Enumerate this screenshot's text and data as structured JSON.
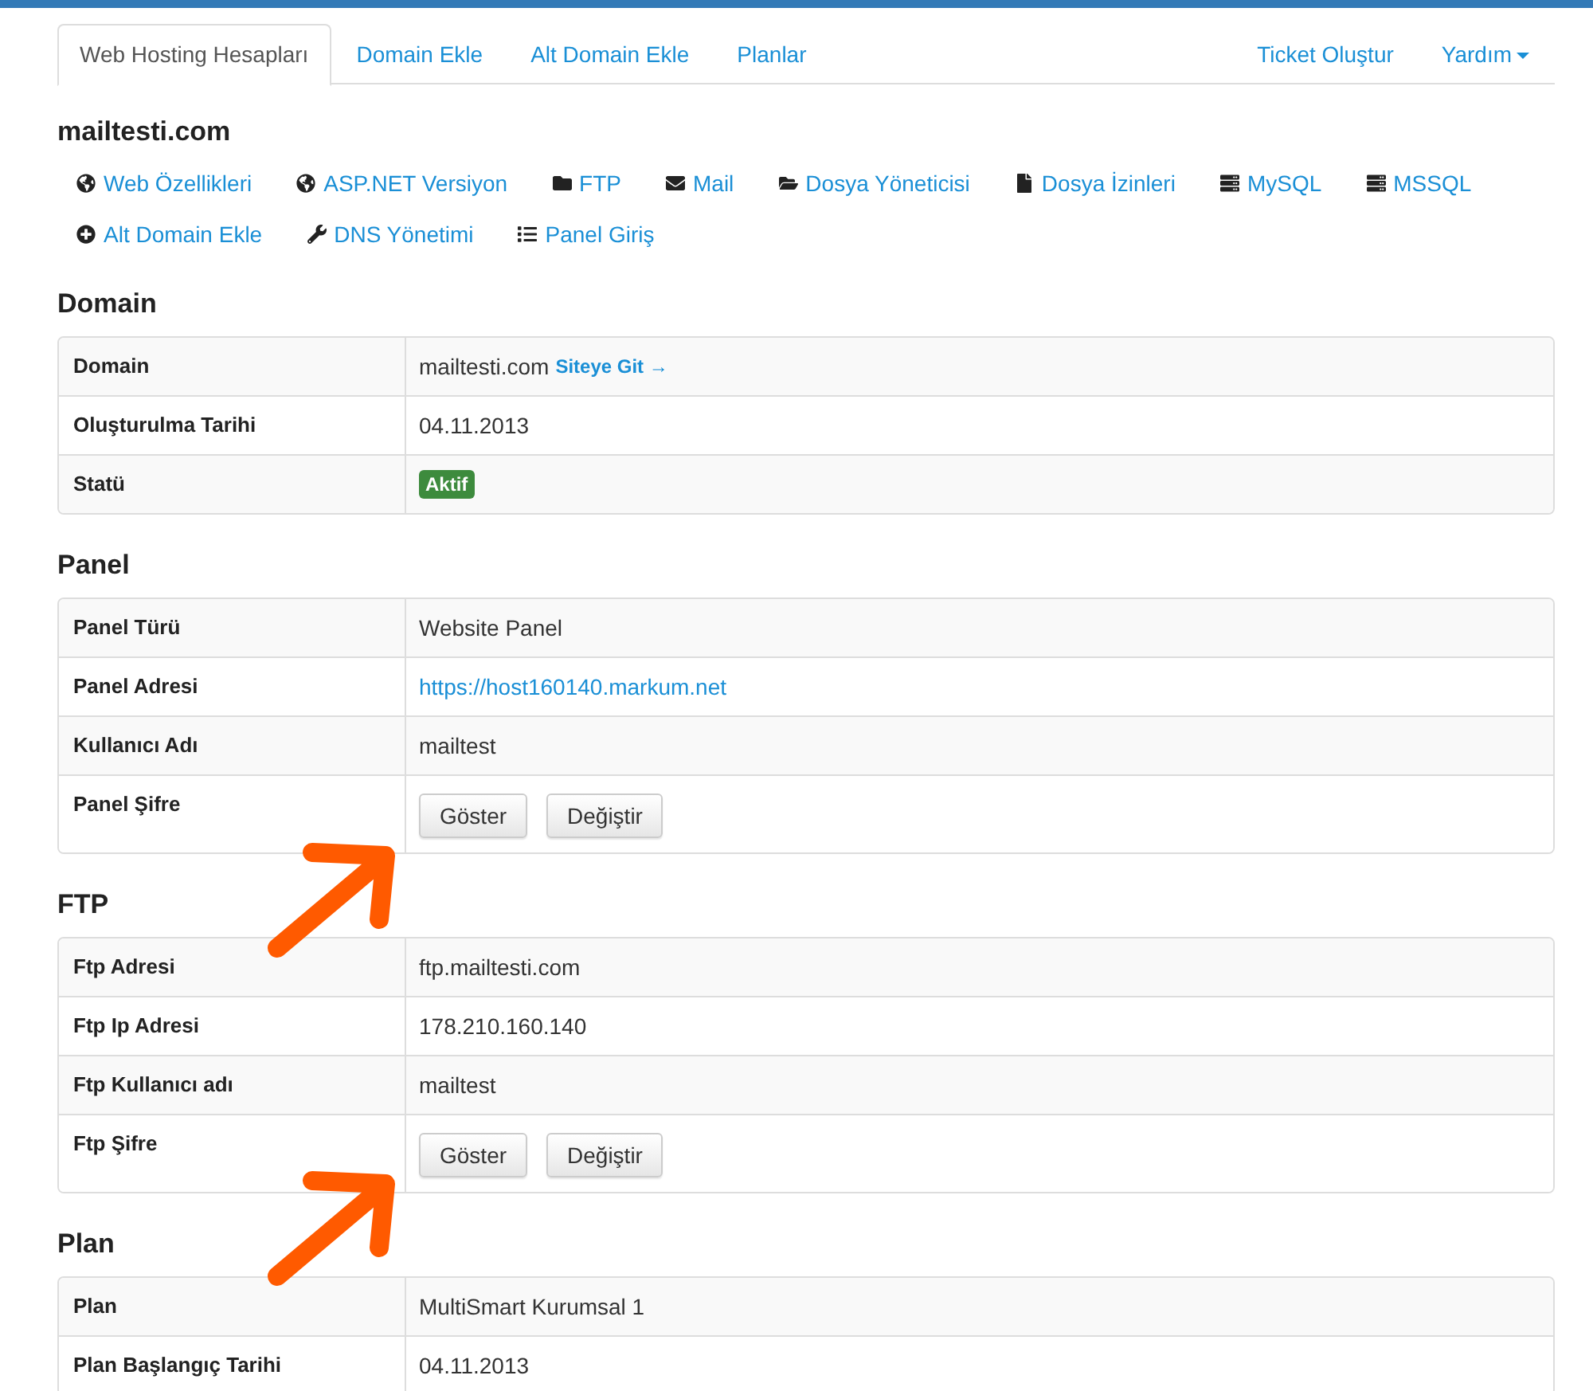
{
  "tabs": [
    {
      "label": "Web Hosting Hesapları",
      "selected": true
    },
    {
      "label": "Domain Ekle",
      "selected": false
    },
    {
      "label": "Alt Domain Ekle",
      "selected": false
    },
    {
      "label": "Planlar",
      "selected": false
    }
  ],
  "right_tabs": [
    {
      "label": "Ticket Oluştur",
      "kind": "link"
    },
    {
      "label": "Yardım",
      "kind": "dropdown"
    }
  ],
  "title": "mailtesti.com",
  "actions": [
    {
      "label": "Web Özellikleri",
      "kind": "globe"
    },
    {
      "label": "ASP.NET Versiyon",
      "kind": "globe"
    },
    {
      "label": "FTP",
      "kind": "folder"
    },
    {
      "label": "Mail",
      "kind": "envelope"
    },
    {
      "label": "Dosya Yöneticisi",
      "kind": "folder-open"
    },
    {
      "label": "Dosya İzinleri",
      "kind": "file"
    },
    {
      "label": "MySQL",
      "kind": "server"
    },
    {
      "label": "MSSQL",
      "kind": "server"
    },
    {
      "label": "Alt Domain Ekle",
      "kind": "plus"
    },
    {
      "label": "DNS Yönetimi",
      "kind": "wrench"
    },
    {
      "label": "Panel Giriş",
      "kind": "list"
    }
  ],
  "sections": [
    {
      "title": "Domain",
      "rows": [
        {
          "label": "Domain",
          "kind": "text-link",
          "value": "mailtesti.com",
          "link": "Siteye Git →"
        },
        {
          "label": "Oluşturulma Tarihi",
          "kind": "text",
          "value": "04.11.2013"
        },
        {
          "label": "Statü",
          "kind": "badge",
          "value": "Aktif"
        }
      ]
    },
    {
      "title": "Panel",
      "rows": [
        {
          "label": "Panel Türü",
          "kind": "text",
          "value": "Website Panel"
        },
        {
          "label": "Panel Adresi",
          "kind": "link",
          "value": "https://host160140.markum.net"
        },
        {
          "label": "Kullanıcı Adı",
          "kind": "text",
          "value": "mailtest"
        },
        {
          "label": "Panel Şifre",
          "kind": "buttons",
          "buttons": [
            "Göster",
            "Değiştir"
          ]
        }
      ]
    },
    {
      "title": "FTP",
      "rows": [
        {
          "label": "Ftp Adresi",
          "kind": "text",
          "value": "ftp.mailtesti.com"
        },
        {
          "label": "Ftp Ip Adresi",
          "kind": "text",
          "value": "178.210.160.140"
        },
        {
          "label": "Ftp Kullanıcı adı",
          "kind": "text",
          "value": "mailtest"
        },
        {
          "label": "Ftp Şifre",
          "kind": "buttons",
          "buttons": [
            "Göster",
            "Değiştir"
          ]
        }
      ]
    },
    {
      "title": "Plan",
      "rows": [
        {
          "label": "Plan",
          "kind": "text",
          "value": "MultiSmart Kurumsal 1"
        },
        {
          "label": "Plan Başlangıç Tarihi",
          "kind": "text",
          "value": "04.11.2013"
        }
      ]
    }
  ]
}
